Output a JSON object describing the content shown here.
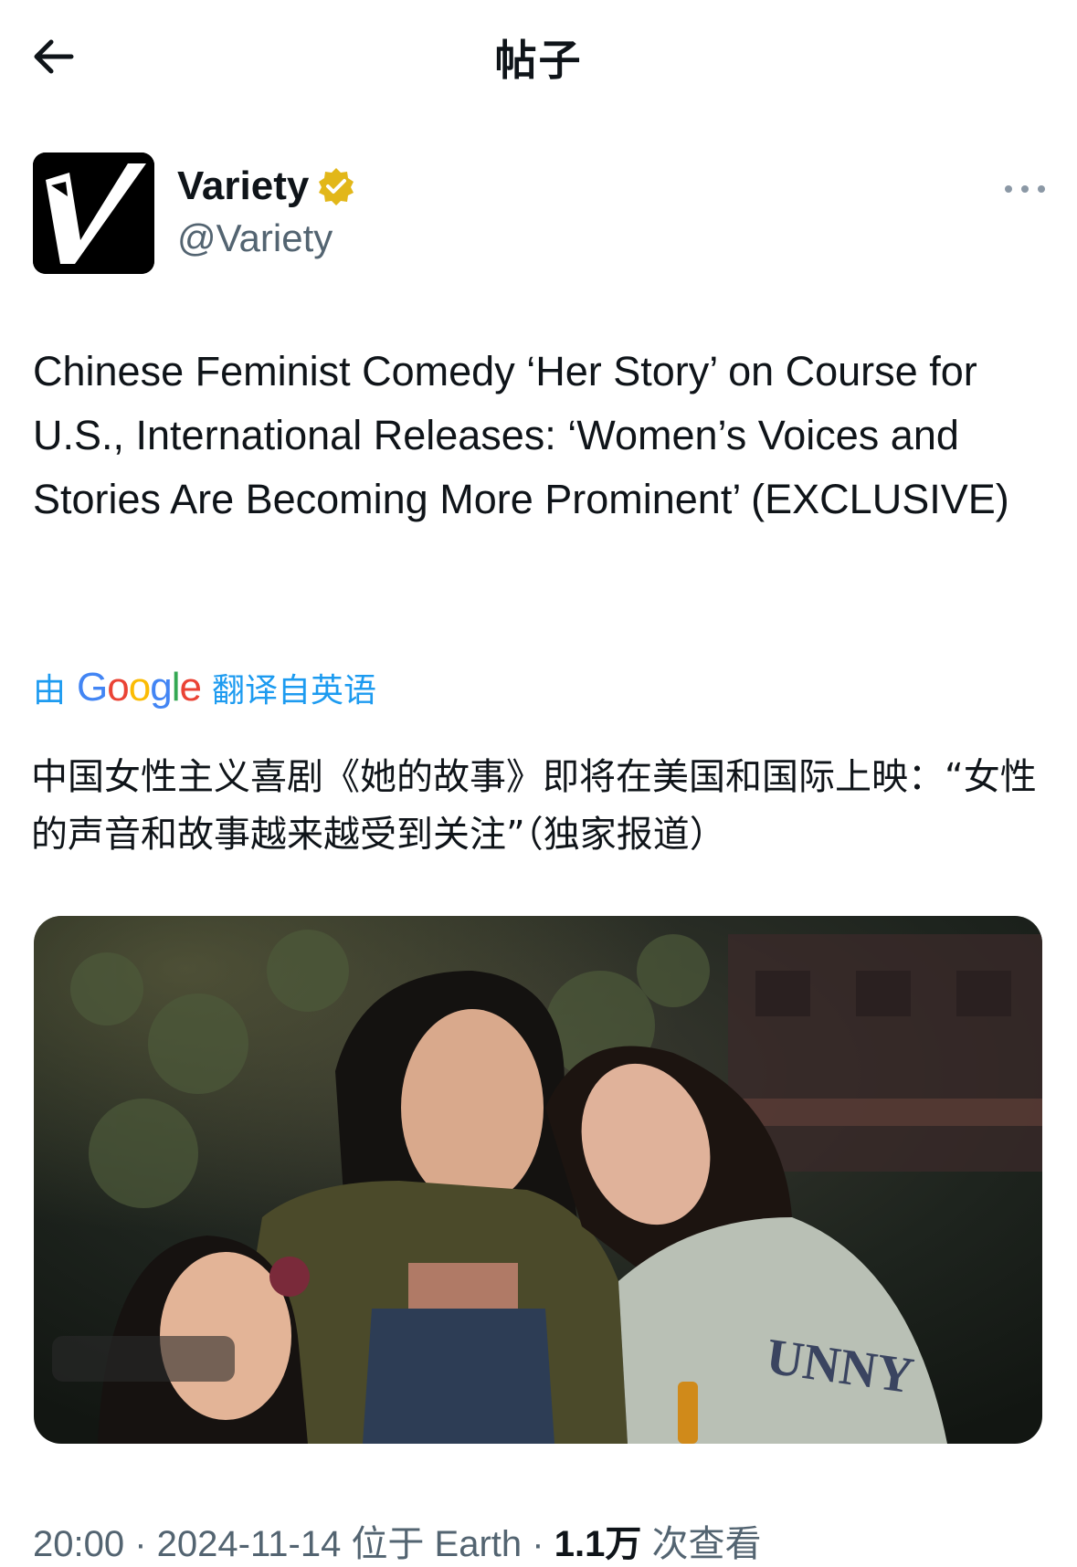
{
  "header": {
    "title": "帖子",
    "back_icon": "arrow-left-icon"
  },
  "author": {
    "display_name": "Variety",
    "handle": "@Variety",
    "verified_color": "#e2b719",
    "avatar_letter": "V"
  },
  "tweet": {
    "text": "Chinese Feminist Comedy ‘Her Story’ on Course for U.S., International Releases: ‘Women’s Voices and Stories Are Becoming More Prominent’ (EXCLUSIVE)"
  },
  "translation": {
    "prefix": "由",
    "provider": "Google",
    "suffix": "翻译自英语",
    "text": "中国女性主义喜剧《她的故事》即将在美国和国际上映：“女性的声音和故事越来越受到关注”（独家报道）"
  },
  "media": {
    "image_text": "UNNY"
  },
  "meta": {
    "time": "20:00",
    "date": "2024-11-14",
    "location": "位于 Earth",
    "views_count": "1.1万",
    "views_label": "次查看"
  },
  "colors": {
    "link": "#1d9bf0",
    "secondary": "#536471",
    "primary_text": "#0f1419"
  }
}
